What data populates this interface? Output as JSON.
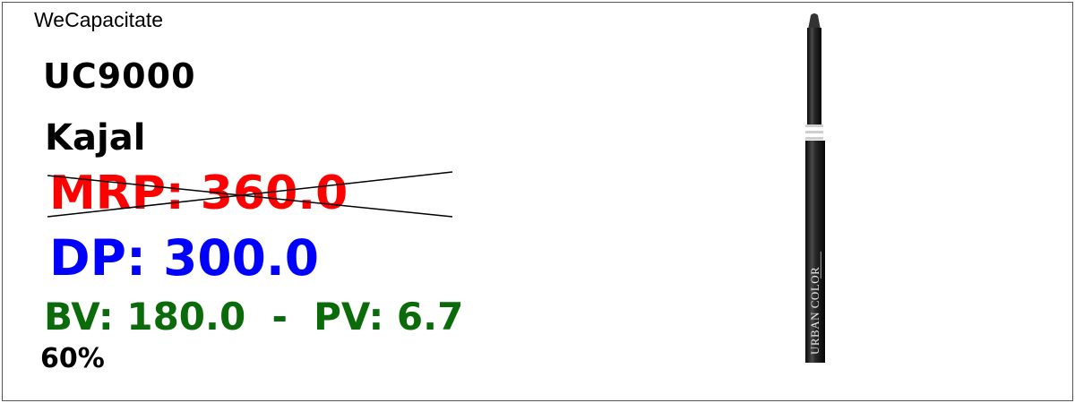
{
  "brand": "WeCapacitate",
  "product": {
    "code": "UC9000",
    "name": "Kajal",
    "mrp_label": "MRP: 360.0",
    "dp_label": "DP: 300.0",
    "bv_pv_label": "BV: 180.0  -  PV: 6.7",
    "discount_label": "60%"
  },
  "image": {
    "label_text": "URBAN COLOR"
  },
  "colors": {
    "mrp": "#ff0000",
    "dp": "#0000ff",
    "bv_pv": "#0b6b0b"
  }
}
